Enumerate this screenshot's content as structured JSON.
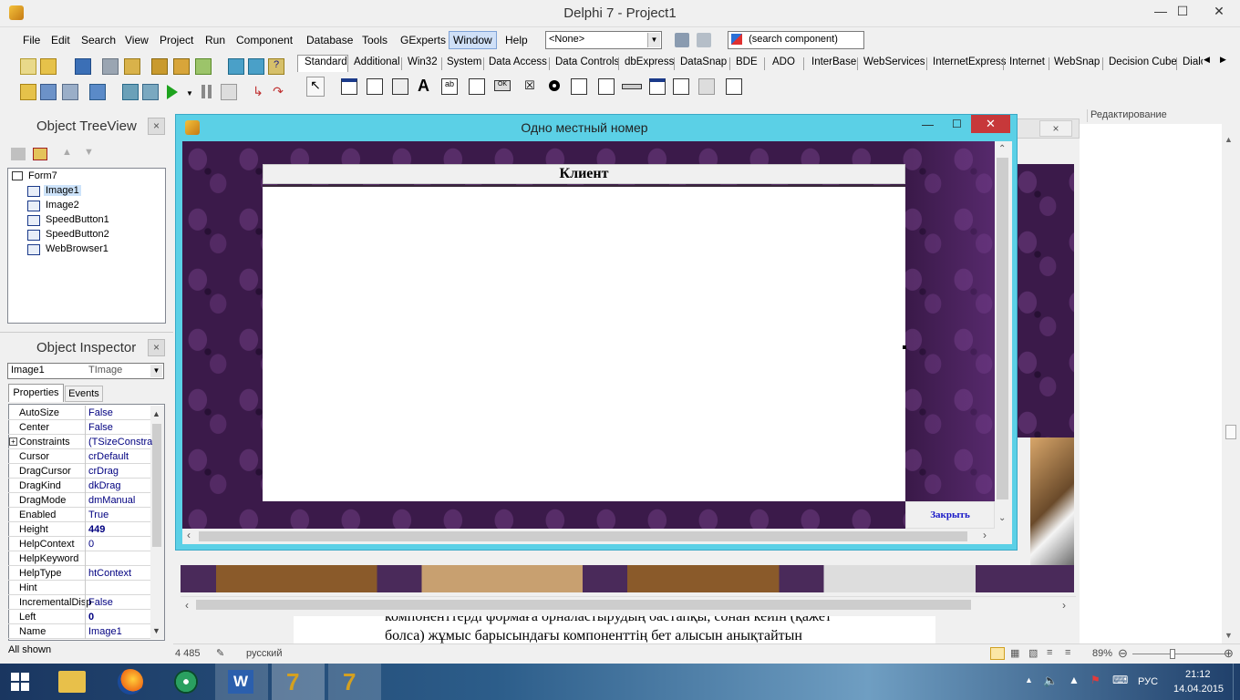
{
  "app": {
    "title": "Delphi 7 - Project1"
  },
  "menu": [
    "File",
    "Edit",
    "Search",
    "View",
    "Project",
    "Run",
    "Component",
    "Database",
    "Tools",
    "GExperts",
    "Window",
    "Help"
  ],
  "toolbar": {
    "config_combo": "<None>",
    "search_component": "(search component)"
  },
  "palette": {
    "tabs": [
      "Standard",
      "Additional",
      "Win32",
      "System",
      "Data Access",
      "Data Controls",
      "dbExpress",
      "DataSnap",
      "BDE",
      "ADO",
      "InterBase",
      "WebServices",
      "InternetExpress",
      "Internet",
      "WebSnap",
      "Decision Cube",
      "Dialo"
    ]
  },
  "treeview": {
    "title": "Object TreeView",
    "items": [
      "Form7",
      "Image1",
      "Image2",
      "SpeedButton1",
      "SpeedButton2",
      "WebBrowser1"
    ]
  },
  "inspector": {
    "title": "Object Inspector",
    "selected_name": "Image1",
    "selected_type": "TImage",
    "tabs": [
      "Properties",
      "Events"
    ],
    "rows": [
      {
        "name": "AutoSize",
        "value": "False"
      },
      {
        "name": "Center",
        "value": "False"
      },
      {
        "name": "Constraints",
        "value": "(TSizeConstra"
      },
      {
        "name": "Cursor",
        "value": "crDefault"
      },
      {
        "name": "DragCursor",
        "value": "crDrag"
      },
      {
        "name": "DragKind",
        "value": "dkDrag"
      },
      {
        "name": "DragMode",
        "value": "dmManual"
      },
      {
        "name": "Enabled",
        "value": "True"
      },
      {
        "name": "Height",
        "value": "449"
      },
      {
        "name": "HelpContext",
        "value": "0"
      },
      {
        "name": "HelpKeyword",
        "value": ""
      },
      {
        "name": "HelpType",
        "value": "htContext"
      },
      {
        "name": "Hint",
        "value": ""
      },
      {
        "name": "IncrementalDisp",
        "value": "False"
      },
      {
        "name": "Left",
        "value": "0"
      },
      {
        "name": "Name",
        "value": "Image1"
      }
    ],
    "status": "All shown"
  },
  "form": {
    "title": "Одно местный номер",
    "header": "Клиент",
    "close_button": "Закрыть"
  },
  "word_bg": {
    "ribbon_label": "Редактирование",
    "text_line1": "компоненттерді формаға орналастырудың бастапқы, сонан кейін (қажет",
    "text_line2": "болса)   жұмыс   барысындағы   компоненттің   бет   алысын   анықтайтын",
    "status_words": "4 485",
    "status_lang": "русский",
    "zoom": "89%"
  },
  "tray": {
    "lang": "РУС",
    "time": "21:12",
    "date": "14.04.2015"
  }
}
